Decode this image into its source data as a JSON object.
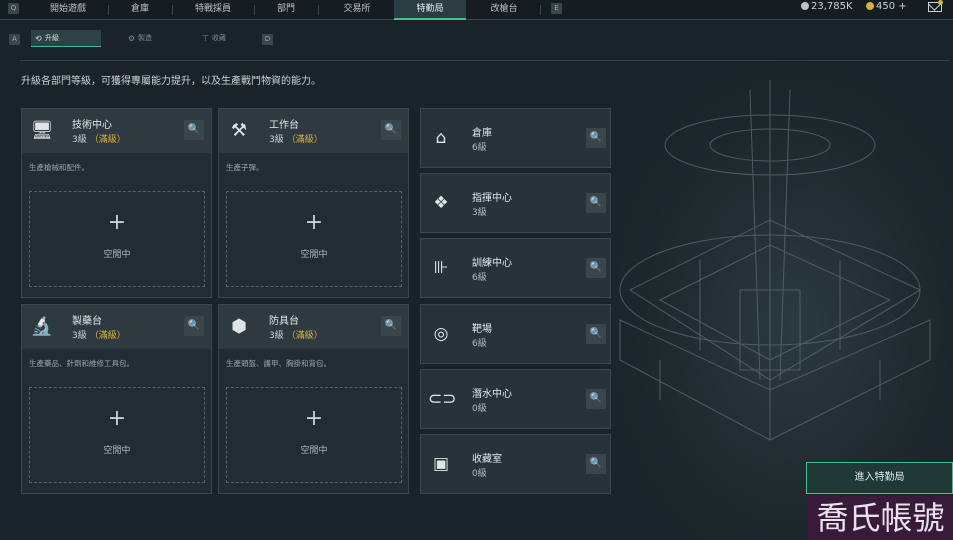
{
  "nav": {
    "key_left": "Q",
    "key_right": "E",
    "tabs": [
      {
        "label": "開始遊戲"
      },
      {
        "label": "倉庫"
      },
      {
        "label": "特戰採員"
      },
      {
        "label": "部門"
      },
      {
        "label": "交易所"
      },
      {
        "label": "特勤局",
        "active": true
      },
      {
        "label": "改槍台"
      }
    ],
    "currency_1": "23,785K",
    "currency_2": "450 +"
  },
  "subnav": {
    "key_left": "A",
    "key_right": "D",
    "tabs": [
      {
        "label": "升級",
        "active": true
      },
      {
        "label": "製造"
      },
      {
        "label": "收藏"
      }
    ]
  },
  "description": "升級各部門等級，可獲得專屬能力提升，以及生產戰鬥物資的能力。",
  "big_cards": [
    {
      "icon": "computer-icon",
      "title": "技術中心",
      "level": "3級",
      "badge": "（滿級）",
      "desc": "生產槍械和配件。",
      "slot_label": "空閒中"
    },
    {
      "icon": "tools-icon",
      "title": "工作台",
      "level": "3級",
      "badge": "（滿級）",
      "desc": "生產子彈。",
      "slot_label": "空閒中"
    },
    {
      "icon": "microscope-icon",
      "title": "製藥台",
      "level": "3級",
      "badge": "（滿級）",
      "desc": "生產藥品、針劑和維修工具包。",
      "slot_label": "空閒中"
    },
    {
      "icon": "cubes-icon",
      "title": "防具台",
      "level": "3級",
      "badge": "（滿級）",
      "desc": "生產頭盔、護甲、胸掛和背包。",
      "slot_label": "空閒中"
    }
  ],
  "small_cards": [
    {
      "icon": "warehouse-icon",
      "title": "倉庫",
      "level": "6級"
    },
    {
      "icon": "command-icon",
      "title": "指揮中心",
      "level": "3級"
    },
    {
      "icon": "dumbbell-icon",
      "title": "訓練中心",
      "level": "6級"
    },
    {
      "icon": "target-icon",
      "title": "靶場",
      "level": "6級"
    },
    {
      "icon": "diving-mask-icon",
      "title": "潛水中心",
      "level": "0級"
    },
    {
      "icon": "collection-icon",
      "title": "收藏室",
      "level": "0級"
    }
  ],
  "enter_button": "進入特勤局",
  "watermark": "喬氏帳號"
}
